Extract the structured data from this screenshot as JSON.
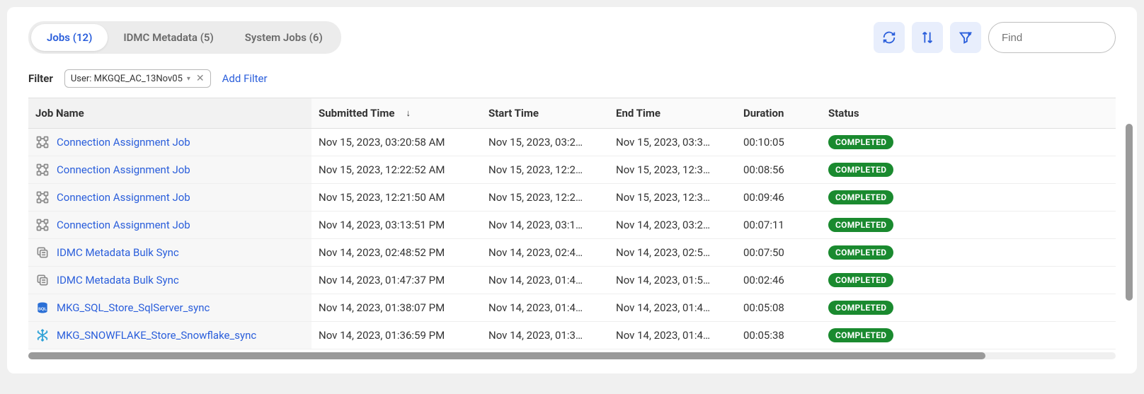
{
  "tabs": [
    {
      "label": "Jobs (12)",
      "active": true
    },
    {
      "label": "IDMC Metadata (5)",
      "active": false
    },
    {
      "label": "System Jobs (6)",
      "active": false
    }
  ],
  "find_placeholder": "Find",
  "filter": {
    "label": "Filter",
    "chip": "User: MKGQE_AC_13Nov05",
    "add_label": "Add Filter"
  },
  "columns": {
    "job_name": "Job Name",
    "submitted_time": "Submitted Time",
    "start_time": "Start Time",
    "end_time": "End Time",
    "duration": "Duration",
    "status": "Status"
  },
  "sort": {
    "column": "submitted_time",
    "direction": "desc"
  },
  "rows": [
    {
      "icon": "hierarchy",
      "job_name": "Connection Assignment Job",
      "submitted": "Nov 15, 2023, 03:20:58 AM",
      "start": "Nov 15, 2023, 03:2…",
      "end": "Nov 15, 2023, 03:3…",
      "duration": "00:10:05",
      "status": "COMPLETED"
    },
    {
      "icon": "hierarchy",
      "job_name": "Connection Assignment Job",
      "submitted": "Nov 15, 2023, 12:22:52 AM",
      "start": "Nov 15, 2023, 12:2…",
      "end": "Nov 15, 2023, 12:3…",
      "duration": "00:08:56",
      "status": "COMPLETED"
    },
    {
      "icon": "hierarchy",
      "job_name": "Connection Assignment Job",
      "submitted": "Nov 15, 2023, 12:21:50 AM",
      "start": "Nov 15, 2023, 12:2…",
      "end": "Nov 15, 2023, 12:3…",
      "duration": "00:09:46",
      "status": "COMPLETED"
    },
    {
      "icon": "hierarchy",
      "job_name": "Connection Assignment Job",
      "submitted": "Nov 14, 2023, 03:13:51 PM",
      "start": "Nov 14, 2023, 03:1…",
      "end": "Nov 14, 2023, 03:2…",
      "duration": "00:07:11",
      "status": "COMPLETED"
    },
    {
      "icon": "copy",
      "job_name": "IDMC Metadata Bulk Sync",
      "submitted": "Nov 14, 2023, 02:48:52 PM",
      "start": "Nov 14, 2023, 02:4…",
      "end": "Nov 14, 2023, 02:5…",
      "duration": "00:07:50",
      "status": "COMPLETED"
    },
    {
      "icon": "copy",
      "job_name": "IDMC Metadata Bulk Sync",
      "submitted": "Nov 14, 2023, 01:47:37 PM",
      "start": "Nov 14, 2023, 01:4…",
      "end": "Nov 14, 2023, 01:5…",
      "duration": "00:02:46",
      "status": "COMPLETED"
    },
    {
      "icon": "sql",
      "job_name": "MKG_SQL_Store_SqlServer_sync",
      "submitted": "Nov 14, 2023, 01:38:07 PM",
      "start": "Nov 14, 2023, 01:4…",
      "end": "Nov 14, 2023, 01:4…",
      "duration": "00:05:08",
      "status": "COMPLETED"
    },
    {
      "icon": "snowflake",
      "job_name": "MKG_SNOWFLAKE_Store_Snowflake_sync",
      "submitted": "Nov 14, 2023, 01:36:59 PM",
      "start": "Nov 14, 2023, 01:3…",
      "end": "Nov 14, 2023, 01:4…",
      "duration": "00:05:38",
      "status": "COMPLETED"
    }
  ]
}
